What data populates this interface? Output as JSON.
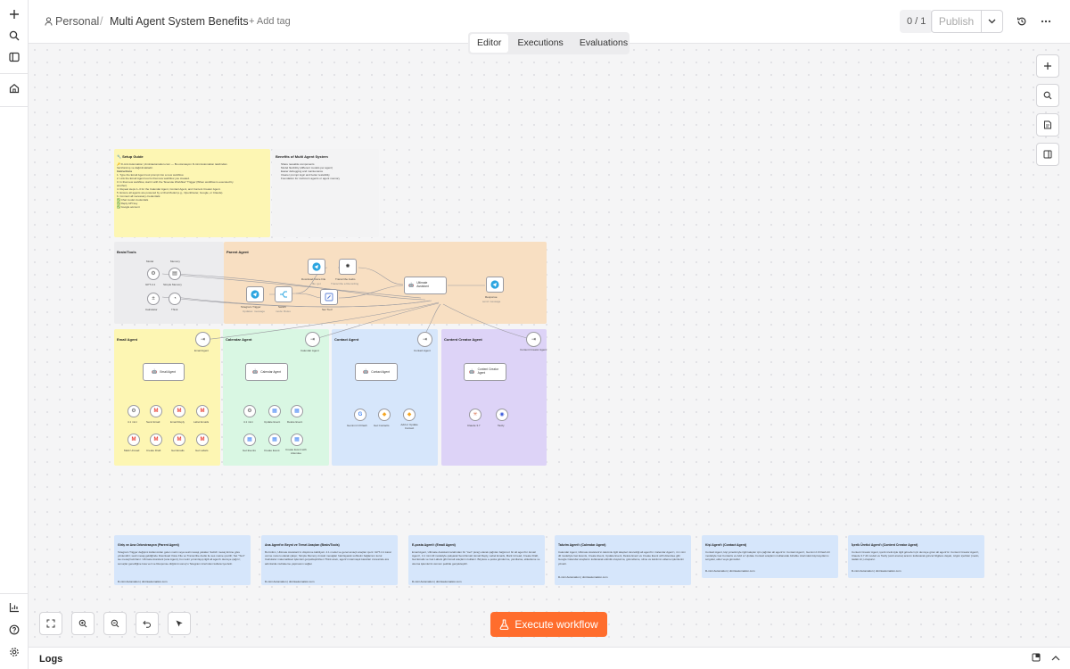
{
  "header": {
    "workspace": "Personal",
    "separator": "/",
    "workflow_name": "Multi Agent System Benefits",
    "add_tag": "+ Add tag",
    "counter": "0 / 1",
    "publish_label": "Publish"
  },
  "tabs": [
    {
      "label": "Editor",
      "active": true
    },
    {
      "label": "Executions",
      "active": false
    },
    {
      "label": "Evaluations",
      "active": false
    }
  ],
  "actions": {
    "execute_label": "Execute workflow"
  },
  "logs": {
    "label": "Logs"
  },
  "canvas": {
    "setup_guide": {
      "title": "🔧 Setup Guide",
      "lines": [
        "🔑 D-mini Automation | dminiautomation.com — Bu otomasyon D-mini Automation tarafından",
        "hazırlanmış ve dağıtılmaktadır.",
        "",
        "Instructions",
        "1. Type the Email Agent tool prompt into a new workflow.",
        "2. Link the Email Agent tool to that new workflow you created.",
        "3. In that new workflow, start it with the \"Execute Workflow\" Trigger (When workflow is executed by",
        "   another).",
        "4. Repeat steps 1–3 for the Calendar Agent, Contact Agent, and Content Creator Agent.",
        "5. Ensure all agents are powered by a Chat Model (e.g., OpenRouter, Google, or Claude).",
        "6. Connect all necessary credentials:",
        "   ✅ Chat model credentials",
        "   ✅ Reply API key",
        "   ✅ Google account"
      ]
    },
    "benefits": {
      "title": "Benefits of Multi Agent System",
      "lines": [
        "Share reusable components",
        "Model flexibility (different models per agent)",
        "Easier debugging and maintenance",
        "Clearer prompt logic and better testability",
        "Foundation for multi-turn agents or agent memory"
      ]
    },
    "brain_tools": {
      "title": "Brain/Tools",
      "nodes": [
        "GPT-4.1",
        "Simple Memory",
        "Calculator",
        "Think"
      ],
      "captions": [
        "Model",
        "Memory"
      ]
    },
    "parent_agent": {
      "title": "Parent Agent",
      "nodes": [
        "Telegram Trigger",
        "Switch",
        "Download Voice File",
        "Transcribe Audio",
        "Set 'Text'",
        "Ultimate Assistant",
        "Response"
      ],
      "captions": [
        "Updates: message",
        "mode: Rules",
        "file: get",
        "Transcribe a Recording",
        "",
        "Tools Agent",
        "send: message"
      ]
    },
    "email_agent": {
      "title": "Email Agent",
      "tool": "Email Agent",
      "agent": "Email Agent",
      "nodes": [
        "4.1 mini",
        "Send Email",
        "Email Reply",
        "Label Emails",
        "Mark Unread",
        "Create Draft",
        "Get Emails",
        "Get Labels"
      ]
    },
    "calendar_agent": {
      "title": "Calendar Agent",
      "tool": "Calendar Agent",
      "agent": "Calendar Agent",
      "nodes": [
        "4.1 mini",
        "Update Event",
        "Delete Event",
        "Get Events",
        "Create Event",
        "Create Event with Attendee"
      ]
    },
    "contact_agent": {
      "title": "Contact Agent",
      "tool": "Contact Agent",
      "agent": "Contact Agent",
      "nodes": [
        "Gemini 2.0 Flash",
        "Get Contacts",
        "Add or Update Contact"
      ]
    },
    "content_creator_agent": {
      "title": "Content Creator Agent",
      "tool": "Content Creator Agent",
      "agent": "Content Creator Agent",
      "nodes": [
        "Claude 3.7",
        "Tavily"
      ]
    },
    "bottom_cards": [
      {
        "title": "Giriş ve Ana Orkestrasyon (Parent Agent)",
        "body": "Telegram Trigger değişimi kullanıcıdan gelen metin veya sesli mesajı yakalar. Switch mesaj türüne göre yönlendirir; sesli mesaj geldiğinde Download Voice File ve Transcribe Audio ile ses metne çevrilir; Set \"Text\" ise mesaj hazırlanır. Ultimate Assistant (ana Agent), bu metni yorumlayıp ilgili alt agent'ı devreye çağırır; sonuçlar genelliğine kısa veri ve Response düğümü sonuç'u Telegram üzerinden kullanıcıya iletir.",
        "footer": "D-mini Automation | dminiautomation.com"
      },
      {
        "title": "Ana Agent'ın Beyni ve Temel Araçları (Brain/Tools)",
        "body": "Bu bölüm, Ultimate Assistant'ın düşünme kabiliyeti. 4.1 model ve genel amaçlı araçları içerir. GPT-4.1 karar verme motoru olarak çalışır, Simple Memory önceki mesajları hatırlayarak sohbetin bağlamını korur. Calculator matematiksel işlemleri gerçekleştirirken Think aracı, agent'ın karmaşık kararları öncesinde ara adımlarda muhakeme yapmasını sağlar.",
        "footer": "D-mini Automation | dminiautomation.com"
      },
      {
        "title": "E-posta Agent'ı (Email Agent)",
        "body": "Email Agent, Ultimate Assistant tarafından bir \"tool\" (araç) olarak çağrılan bağımsız bir alt agent'tır. Email Agent'ı, 4.1 mini dil modeliyle çalışarak Send Email, Email Reply, Label Emails, Mark Unread, Create Draft, Get Emails ve Get Labels gibi Gmail araçlarını kullanır. Böylece e-posta gönderme, yanıtlama, etiketleme ve okuma işlemlerini otonom şekilde gerçekleştirir.",
        "footer": "D-mini Automation | dminiautomation.com"
      },
      {
        "title": "Takvim Agent'ı (Calendar Agent)",
        "body": "Calendar Agent, Ultimate Assistant'ın takvimle ilgili talepleri devrettiği alt agent'tır. Calendar Agent'ı, 4.1 mini dil modeliyle Get Events, Create Event, Update Event, Delete Event ve Create Event with Attendee gibi Google Calendar araçlarını kullanarak etkinlik oluşturma, güncelleme, silme ve katılımcı ekleme işlemlerini yönetir.",
        "footer": "D-mini Automation | dminiautomation.com"
      },
      {
        "title": "Kişi Agent'ı (Contact Agent)",
        "body": "Contact Agent, kişi yönetimiyle ilgili talepler için çağrılan alt agent'tır. Contact Agent'ı, Gemini 2.0 Flash dil modeliyle Get Contacts ve Add or Update Contact araçlarını kullanarak Airtable üzerindeki kişi kayıtlarını sorgular, ekler veya günceller.",
        "footer": "D-mini Automation | dminiautomation.com"
      },
      {
        "title": "İçerik Üretici Agent'ı (Content Creator Agent)",
        "body": "Content Creator Agent, içerik üretimiyle ilgili görevler için devreye giren alt agent'tır. Content Creator Agent'ı, Claude 3.7 dil modeli ve Tavily (web arama) aracını kullanarak güncel bilgilere dayalı, özgün içerikler (metin, taslak vb.) oluşturur.",
        "footer": "D-mini Automation | dminiautomation.com"
      }
    ]
  },
  "colors": {
    "accent": "#ff6d2d",
    "yellow_note": "#fdf6b3",
    "parent_group": "#f8dfc2",
    "calendar_group": "#d9f7e3",
    "contact_group": "#d6e6fb",
    "creator_group": "#ddd3f7",
    "bottom_card": "#d6e6fb",
    "telegram": "#2ba5e0",
    "gmail_red": "#ea4335"
  },
  "icons": {
    "rail": [
      "plus-icon",
      "search-icon",
      "panel-icon",
      "home-icon",
      "chart-icon",
      "help-icon",
      "settings-icon"
    ],
    "header": [
      "history-icon",
      "more-icon"
    ],
    "canvas_right": [
      "zoom-add-icon",
      "find-icon",
      "sticky-note-icon",
      "panel-toggle-icon"
    ],
    "canvas_bottom": [
      "fit-view-icon",
      "zoom-in-icon",
      "zoom-out-icon",
      "undo-icon",
      "tidy-up-icon"
    ],
    "logs": [
      "popout-icon",
      "chevron-up-icon"
    ]
  }
}
